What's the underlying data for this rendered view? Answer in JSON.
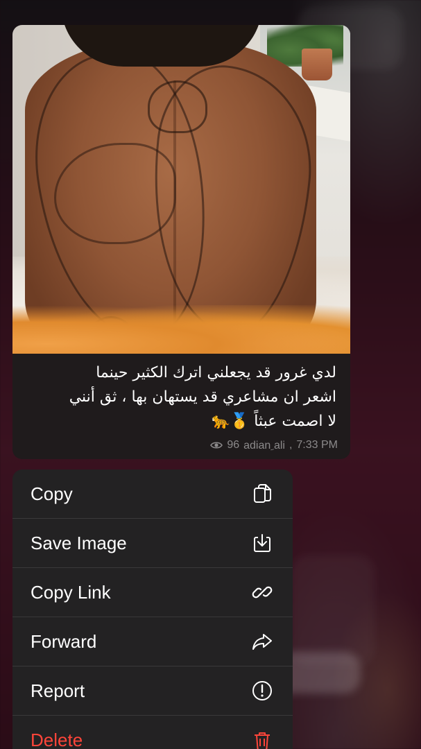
{
  "message": {
    "caption_lines": [
      "لدي غرور قد يجعلني اترك الكثير حينما",
      "اشعر ان مشاعري قد يستهان بها ، ثق أنني",
      "لا اصمت عبثاً 🥇🐆"
    ],
    "views": "96",
    "author": "adian ِali",
    "time": "7:33 PM",
    "icon": "eye-icon"
  },
  "context_menu": {
    "items": [
      {
        "label": "Copy",
        "icon": "copy-icon"
      },
      {
        "label": "Save Image",
        "icon": "save-image-icon"
      },
      {
        "label": "Copy Link",
        "icon": "link-icon"
      },
      {
        "label": "Forward",
        "icon": "forward-icon"
      },
      {
        "label": "Report",
        "icon": "report-icon"
      },
      {
        "label": "Delete",
        "icon": "trash-icon"
      }
    ],
    "danger_color": "#ff453a"
  },
  "colors": {
    "bubble_bg": "#1f1b1c",
    "menu_bg": "#232223",
    "meta_text": "#8c8a8b"
  }
}
